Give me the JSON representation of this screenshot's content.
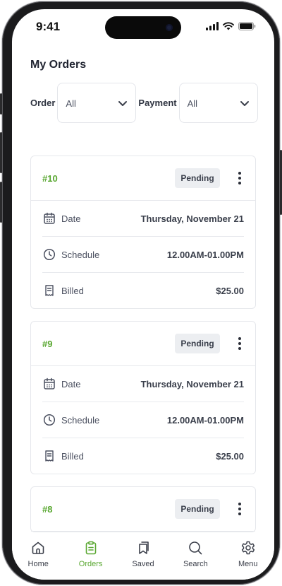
{
  "status_bar": {
    "time": "9:41"
  },
  "header": {
    "title": "My Orders"
  },
  "filters": {
    "order": {
      "label": "Order",
      "value": "All"
    },
    "payment": {
      "label": "Payment",
      "value": "All"
    }
  },
  "orders": [
    {
      "id": "#10",
      "status": "Pending",
      "date_label": "Date",
      "date": "Thursday, November 21",
      "schedule_label": "Schedule",
      "schedule": "12.00AM-01.00PM",
      "billed_label": "Billed",
      "billed": "$25.00"
    },
    {
      "id": "#9",
      "status": "Pending",
      "date_label": "Date",
      "date": "Thursday, November 21",
      "schedule_label": "Schedule",
      "schedule": "12.00AM-01.00PM",
      "billed_label": "Billed",
      "billed": "$25.00"
    },
    {
      "id": "#8",
      "status": "Pending"
    }
  ],
  "tabbar": {
    "items": [
      {
        "label": "Home",
        "icon": "home-icon",
        "active": false
      },
      {
        "label": "Orders",
        "icon": "clipboard-icon",
        "active": true
      },
      {
        "label": "Saved",
        "icon": "bookmark-icon",
        "active": false
      },
      {
        "label": "Search",
        "icon": "search-icon",
        "active": false
      },
      {
        "label": "Menu",
        "icon": "gear-icon",
        "active": false
      }
    ]
  },
  "colors": {
    "accent": "#5aa832",
    "badge_bg": "#eceef1",
    "text": "#1f2330"
  }
}
